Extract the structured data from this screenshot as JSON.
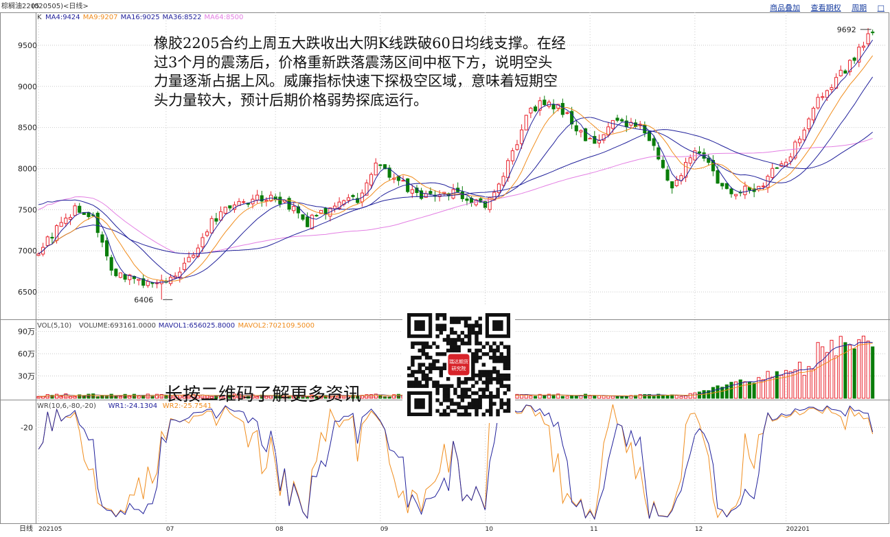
{
  "window": {
    "title": "棕榈油2205",
    "code": "(020505)",
    "period": "<日线>",
    "links": [
      "商品叠加",
      "查看期权",
      "周期",
      "□"
    ]
  },
  "main_panel": {
    "label": "K",
    "ma_labels": [
      {
        "text": "MA4:9424",
        "color": "#1f1f9a"
      },
      {
        "text": "MA9:9207",
        "color": "#f08c1c"
      },
      {
        "text": "MA16:9025",
        "color": "#1f1f9a"
      },
      {
        "text": "MA36:8522",
        "color": "#1f1f9a"
      },
      {
        "text": "MA64:8500",
        "color": "#e37ee3"
      }
    ],
    "high_marker": "9692",
    "low_marker": "6406"
  },
  "vol_panel": {
    "labels": [
      {
        "text": "VOL(5,10)",
        "color": "#444"
      },
      {
        "text": "VOLUME:693161.0000",
        "color": "#444"
      },
      {
        "text": "MAVOL1:656025.8000",
        "color": "#1f1f9a"
      },
      {
        "text": "MAVOL2:702109.5000",
        "color": "#f08c1c"
      }
    ]
  },
  "wr_panel": {
    "labels": [
      {
        "text": "WR(10,6,-80,-20)",
        "color": "#444"
      },
      {
        "text": "WR1:-24.1304",
        "color": "#1f1f9a"
      },
      {
        "text": "WR2:-25.7541",
        "color": "#f08c1c"
      }
    ]
  },
  "annotation": "橡胶2205合约上周五大跌收出大阴K线跌破60日均线支撑。在经过3个月的震荡后，价格重新跌落震荡区间中枢下方，说明空头力量逐渐占据上风。威廉指标快速下探极空区域，意味着短期空头力量较大，预计后期价格弱势探底运行。",
  "qr": {
    "caption": "长按二维码了解更多资讯",
    "logo_line1": "瑞达期货",
    "logo_line2": "研究院"
  },
  "x_axis": {
    "period_label": "日线",
    "months": [
      "202105",
      "07",
      "08",
      "09",
      "10",
      "11",
      "12",
      "202201"
    ]
  },
  "chart_data": [
    {
      "type": "candlestick",
      "y_ticks": [
        6500,
        7000,
        7500,
        8000,
        8500,
        9000,
        9500
      ],
      "ylim": [
        6200,
        9850
      ],
      "n": 184,
      "anchors": [
        [
          0,
          7020
        ],
        [
          12,
          7500
        ],
        [
          18,
          7400
        ],
        [
          25,
          6750
        ],
        [
          38,
          6550
        ],
        [
          46,
          6750
        ],
        [
          50,
          6900
        ],
        [
          58,
          7350
        ],
        [
          66,
          7600
        ],
        [
          80,
          7650
        ],
        [
          90,
          7350
        ],
        [
          100,
          7600
        ],
        [
          108,
          7650
        ],
        [
          112,
          8050
        ],
        [
          122,
          7800
        ],
        [
          130,
          7650
        ],
        [
          140,
          7700
        ],
        [
          150,
          7550
        ],
        [
          158,
          8150
        ],
        [
          164,
          8700
        ],
        [
          170,
          8850
        ],
        [
          178,
          8600
        ],
        [
          186,
          8250
        ],
        [
          192,
          8550
        ],
        [
          202,
          8500
        ],
        [
          212,
          7800
        ],
        [
          220,
          8250
        ],
        [
          230,
          7700
        ],
        [
          240,
          7750
        ],
        [
          252,
          8200
        ],
        [
          262,
          8900
        ],
        [
          270,
          9200
        ],
        [
          279,
          9692
        ]
      ],
      "low_label": 6406,
      "high_label": 9692
    },
    {
      "type": "bar",
      "name": "VOL",
      "y_ticks": [
        [
          "30万",
          300000
        ],
        [
          "60万",
          600000
        ],
        [
          "90万",
          900000
        ]
      ],
      "ylim": [
        0,
        980000
      ],
      "last": 693161
    },
    {
      "type": "line",
      "name": "WR",
      "y_ticks": [
        -20
      ],
      "ylim": [
        0,
        -100
      ],
      "last_wr1": -24.1304,
      "last_wr2": -25.7541
    }
  ],
  "colors": {
    "up": "#e8202a",
    "down": "#0a7d0a",
    "grid": "#c9c9c9",
    "axis_text": "#222",
    "border": "#888",
    "ma4": "#1f1f9a",
    "ma9": "#f08c1c",
    "ma16": "#1f1f9a",
    "ma36": "#1f1f9a",
    "ma64": "#e37ee3"
  }
}
